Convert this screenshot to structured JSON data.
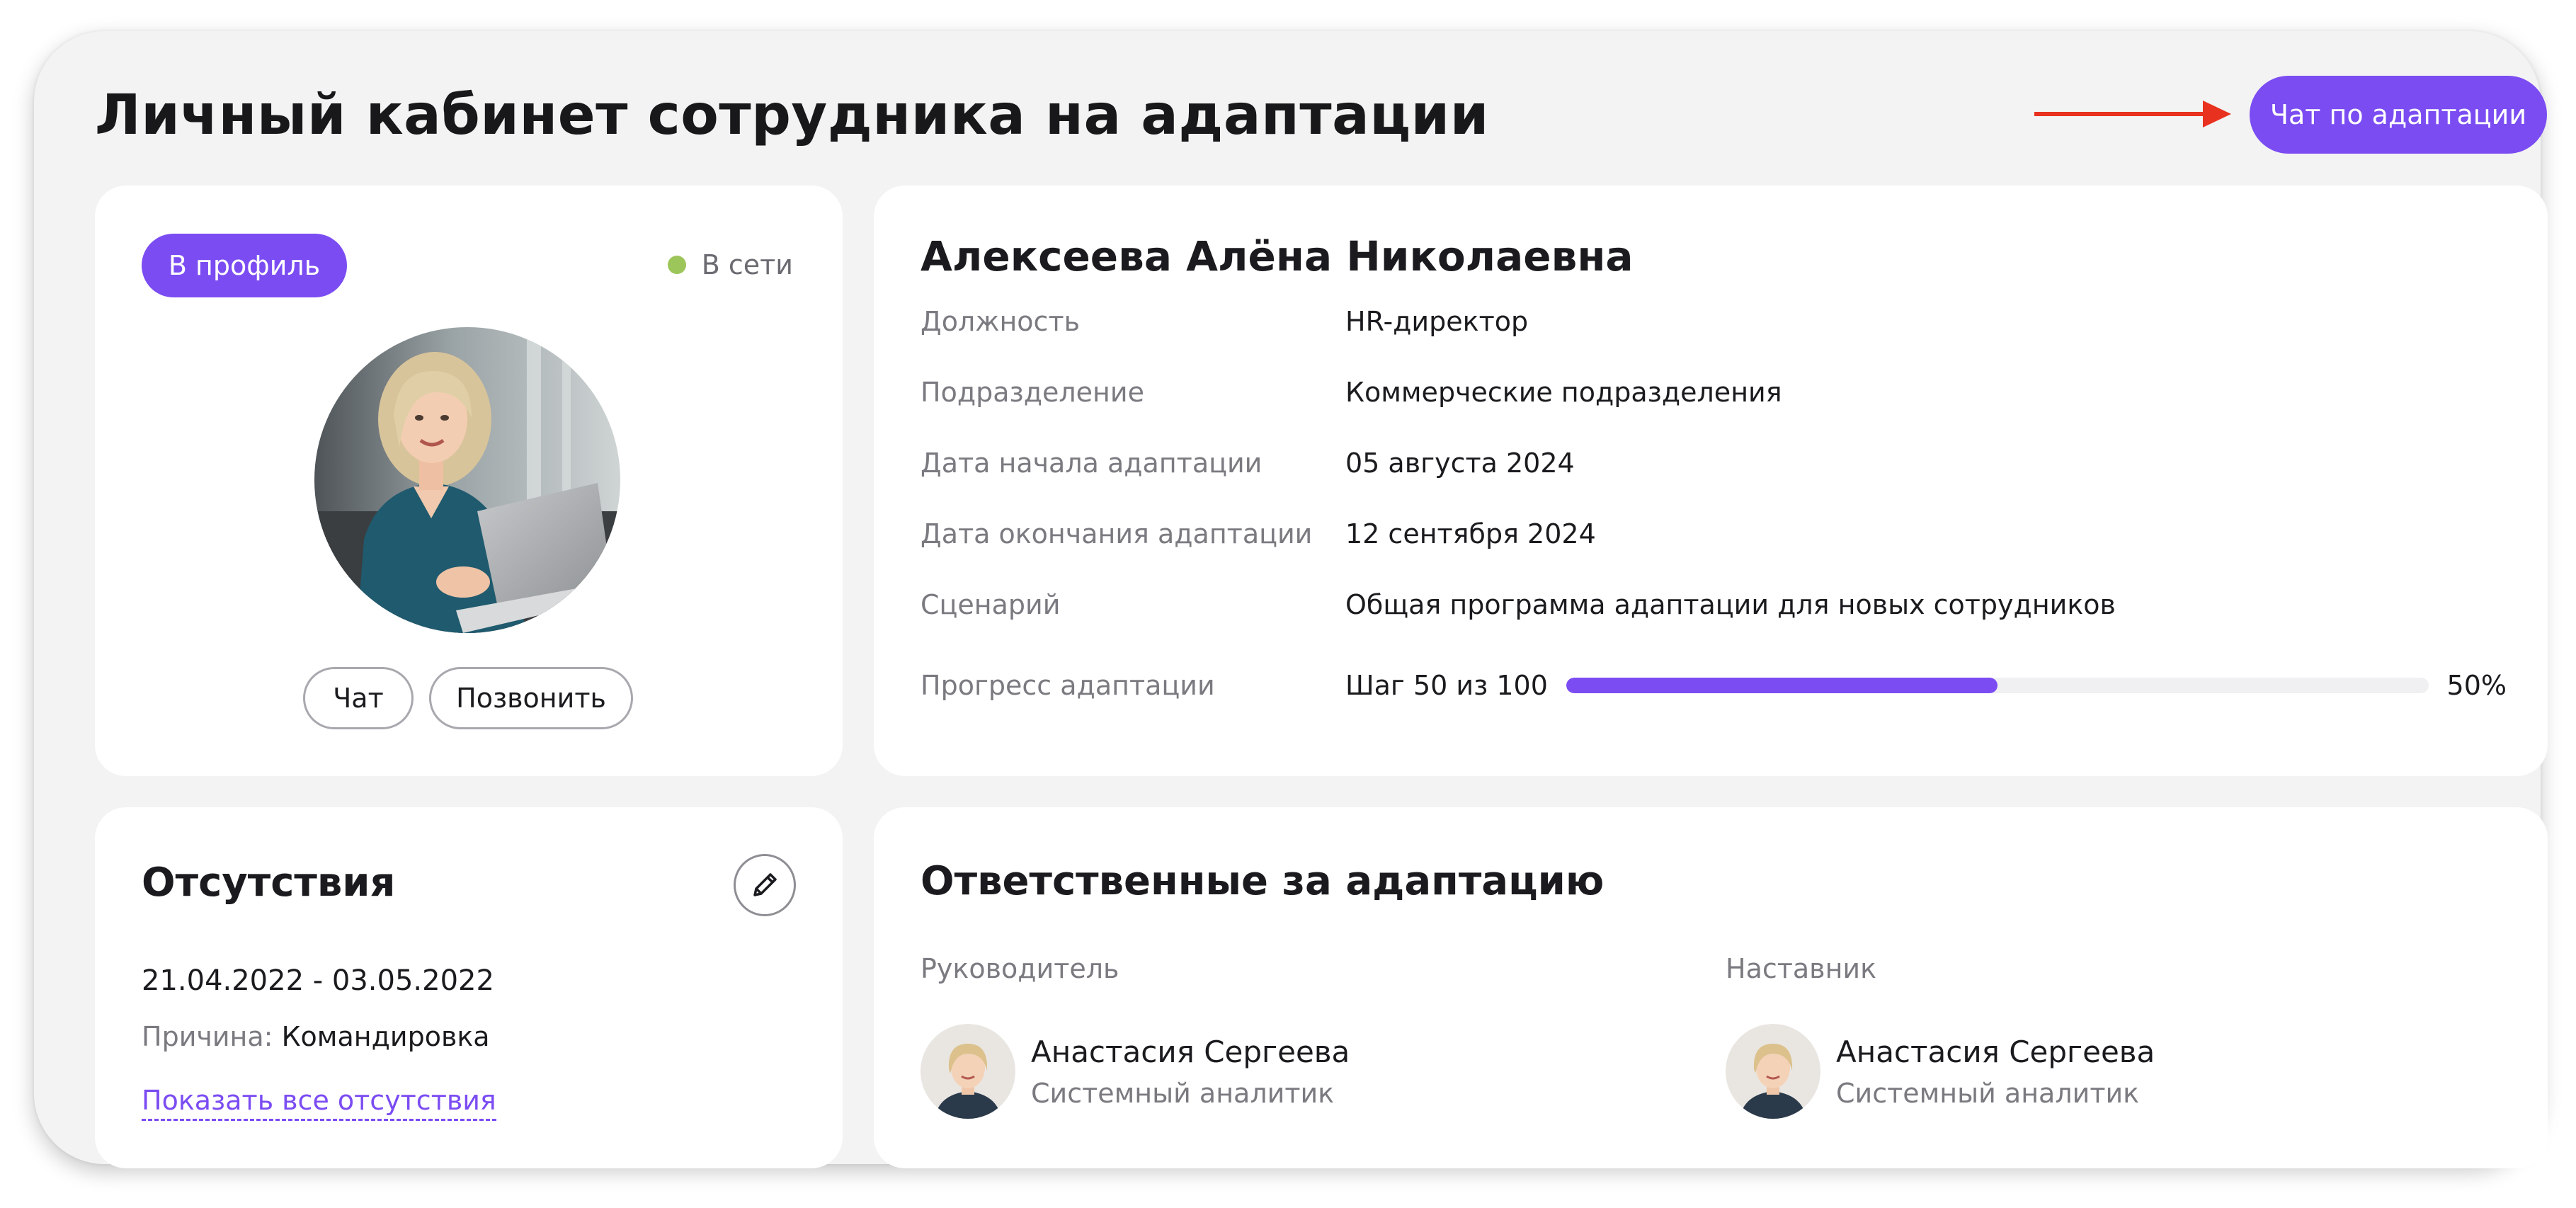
{
  "header": {
    "title": "Личный кабинет сотрудника на адаптации",
    "chat_button_label": "Чат по адаптации"
  },
  "profile_card": {
    "profile_button_label": "В профиль",
    "status_label": "В сети",
    "chat_button_label": "Чат",
    "call_button_label": "Позвонить"
  },
  "employee": {
    "full_name": "Алексеева Алёна Николаевна",
    "fields": [
      {
        "label": "Должность",
        "value": "HR-директор"
      },
      {
        "label": "Подразделение",
        "value": "Коммерческие подразделения"
      },
      {
        "label": "Дата начала адаптации",
        "value": "05 августа 2024"
      },
      {
        "label": "Дата окончания адаптации",
        "value": "12 сентября 2024"
      },
      {
        "label": "Сценарий",
        "value": "Общая программа адаптации для новых сотрудников"
      }
    ],
    "progress": {
      "label": "Прогресс адаптации",
      "step_text": "Шаг 50 из 100",
      "percent_text": "50%",
      "fraction": 0.5
    }
  },
  "absences": {
    "title": "Отсутствия",
    "date_range": "21.04.2022 - 03.05.2022",
    "reason_label": "Причина:",
    "reason_value": "Командировка",
    "show_all_link": "Показать все отсутствия"
  },
  "responsible": {
    "title": "Ответственные за адаптацию",
    "people": [
      {
        "role": "Руководитель",
        "name": "Анастасия Сергеева",
        "position": "Системный аналитик"
      },
      {
        "role": "Наставник",
        "name": "Анастасия Сергеева",
        "position": "Системный аналитик"
      }
    ]
  },
  "colors": {
    "accent": "#7b4cf2",
    "online": "#9cc55a",
    "arrow": "#e8321f"
  },
  "icons": {
    "edit": "pencil-icon",
    "arrow": "arrow-right-icon",
    "status": "online-dot-icon"
  }
}
